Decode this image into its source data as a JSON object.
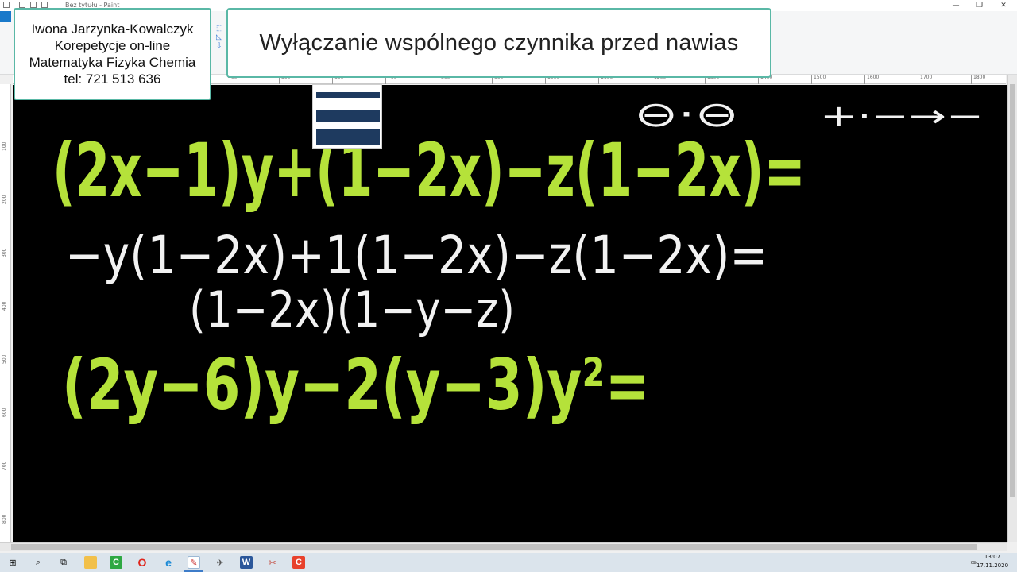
{
  "app": {
    "window_title": "Bez tytułu - Paint"
  },
  "info_box": {
    "line1": "Iwona Jarzynka-Kowalczyk",
    "line2": "Korepetycje on-line",
    "line3": "Matematyka Fizyka Chemia",
    "line4": "tel: 721 513 636"
  },
  "lesson_title": "Wyłączanie wspólnego czynnika przed nawias",
  "ruler": {
    "ticks": [
      "400",
      "500",
      "600",
      "700",
      "800",
      "900",
      "1000",
      "1100",
      "1200",
      "1300",
      "1400",
      "1500",
      "1600",
      "1700",
      "1800"
    ]
  },
  "vruler": {
    "ticks": [
      "100",
      "200",
      "300",
      "400",
      "500",
      "600",
      "700",
      "800"
    ]
  },
  "canvas": {
    "line1": "(2x−1)y+(1−2x)−z(1−2x)=",
    "line2": "−y(1−2x)+1(1−2x)−z(1−2x)=",
    "line3": "(1−2x)(1−y−z)",
    "line4": "(2y−6)y−2(y−3)y²=",
    "note_signs": "⊖·⊖",
    "note_rule": "+·−→−",
    "colors": {
      "canvas_bg": "#000000",
      "green_chalk": "#b5e23a",
      "white_chalk": "#f2f2f2"
    }
  },
  "taskbar": {
    "time": "13:07",
    "date": "17.11.2020",
    "icons": [
      "windows-start-icon",
      "search-icon",
      "task-view-icon",
      "file-explorer-icon",
      "green-app-icon",
      "opera-icon",
      "edge-icon",
      "paint-icon",
      "plane-app-icon",
      "word-icon",
      "snipping-icon",
      "red-app-icon"
    ]
  }
}
